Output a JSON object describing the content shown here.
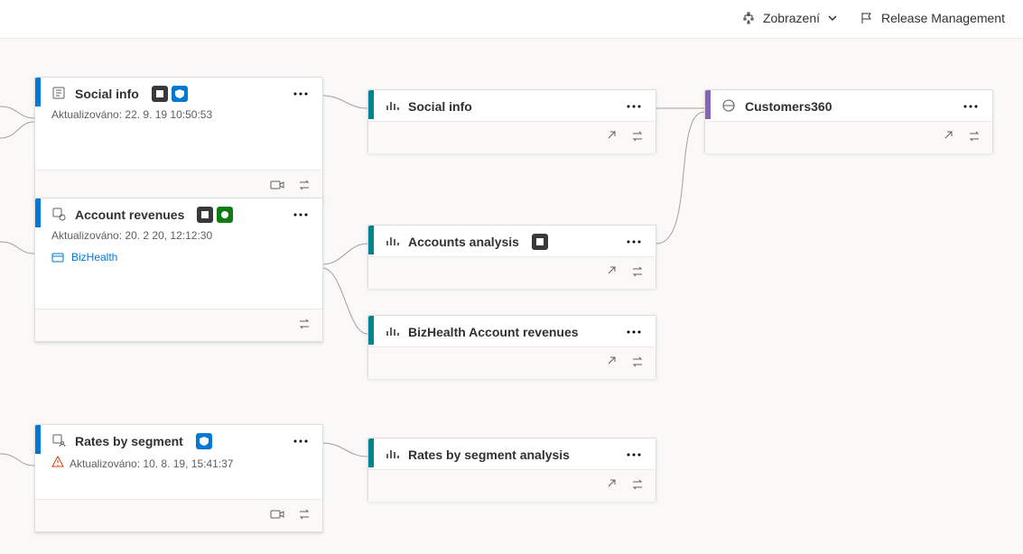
{
  "toolbar": {
    "view_label": "Zobrazení",
    "release_label": "Release Management"
  },
  "labels": {
    "updated_prefix": "Aktualizováno: "
  },
  "nodes": {
    "social_info_ds": {
      "title": "Social info",
      "updated": "22. 9. 19 10:50:53"
    },
    "account_revenues_ds": {
      "title": "Account revenues",
      "updated": "20. 2 20, 12:12:30",
      "workspace": "BizHealth"
    },
    "rates_by_segment_ds": {
      "title": "Rates by segment",
      "updated": "10. 8. 19, 15:41:37"
    },
    "social_info_rpt": {
      "title": "Social info"
    },
    "accounts_analysis_rpt": {
      "title": "Accounts analysis"
    },
    "bizhealth_rev_rpt": {
      "title": "BizHealth Account revenues"
    },
    "rates_analysis_rpt": {
      "title": "Rates by segment analysis"
    },
    "customers360_app": {
      "title": "Customers360"
    }
  }
}
